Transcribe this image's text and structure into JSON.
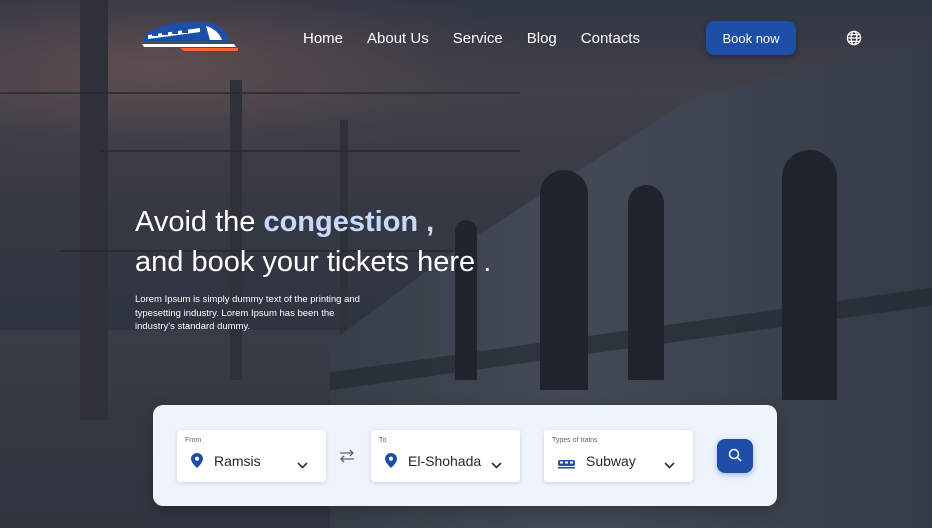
{
  "nav": {
    "links": [
      "Home",
      "About Us",
      "Service",
      "Blog",
      "Contacts"
    ],
    "book_label": "Book now"
  },
  "hero": {
    "headline_pre": "Avoid the ",
    "headline_accent": "congestion ,",
    "headline_line2": "and book your tickets here .",
    "description": "Lorem Ipsum is simply dummy text of the printing and typesetting industry. Lorem Ipsum has been the industry's standard dummy."
  },
  "search": {
    "from": {
      "label": "From",
      "value": "Ramsis",
      "icon": "map-pin-icon"
    },
    "to": {
      "label": "To",
      "value": "El-Shohada",
      "icon": "map-pin-icon"
    },
    "train_type": {
      "label": "Types of trains",
      "value": "Subway",
      "icon": "train-icon"
    },
    "swap_icon": "swap-arrows-icon",
    "search_icon": "search-icon"
  },
  "colors": {
    "primary": "#1d4ea8",
    "accent_text": "#c9d8ff",
    "panel_bg": "#eef3fc",
    "logo_orange": "#f06a32"
  }
}
